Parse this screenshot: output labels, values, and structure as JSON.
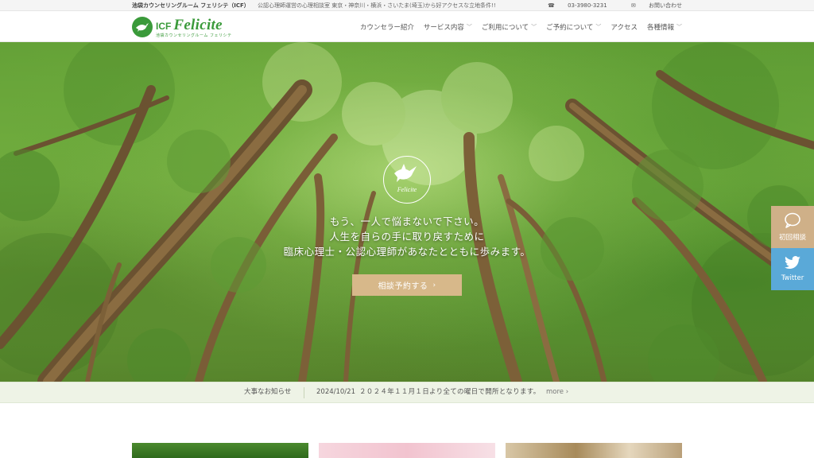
{
  "topbar": {
    "brand_name": "池袋カウンセリングルーム フェリシテ（ICF）",
    "tagline": "公認心理師運営の心理相談室 東京・神奈川・横浜・さいたま(埼玉)から好アクセスな立地条件!!",
    "phone": "03-3980-3231",
    "contact_label": "お問い合わせ"
  },
  "logo": {
    "prefix": "ICF",
    "name": "Felicite",
    "sub": "池袋カウンセリングルーム フェリシテ"
  },
  "nav": [
    {
      "label": "カウンセラー紹介",
      "dropdown": false
    },
    {
      "label": "サービス内容",
      "dropdown": true
    },
    {
      "label": "ご利用について",
      "dropdown": true
    },
    {
      "label": "ご予約について",
      "dropdown": true
    },
    {
      "label": "アクセス",
      "dropdown": false
    },
    {
      "label": "各種情報",
      "dropdown": true
    }
  ],
  "hero": {
    "emblem_label": "Felicite",
    "lines": [
      "もう、一人で悩まないで下さい。",
      "人生を自らの手に取り戻すために",
      "臨床心理士・公認心理師があなたとともに歩みます。"
    ],
    "cta_label": "相談予約する",
    "cta_arrow": "›"
  },
  "side_buttons": {
    "consult_label": "初回相談",
    "twitter_label": "Twitter"
  },
  "news": {
    "label": "大事なお知らせ",
    "date": "2024/10/21",
    "message": "２０２４年１１月１日より全ての曜日で開所となります。",
    "more_label": "more",
    "more_arrow": "›"
  },
  "colors": {
    "brand_green": "#3a9a3a",
    "cta_beige": "#d7b88a",
    "twitter_blue": "#5aa9d8",
    "news_bg": "#eef3e6"
  },
  "icons": {
    "phone": "phone-icon",
    "mail": "mail-icon",
    "chevron": "chevron-down-icon",
    "chat": "chat-bubble-icon",
    "twitter": "twitter-bird-icon"
  }
}
